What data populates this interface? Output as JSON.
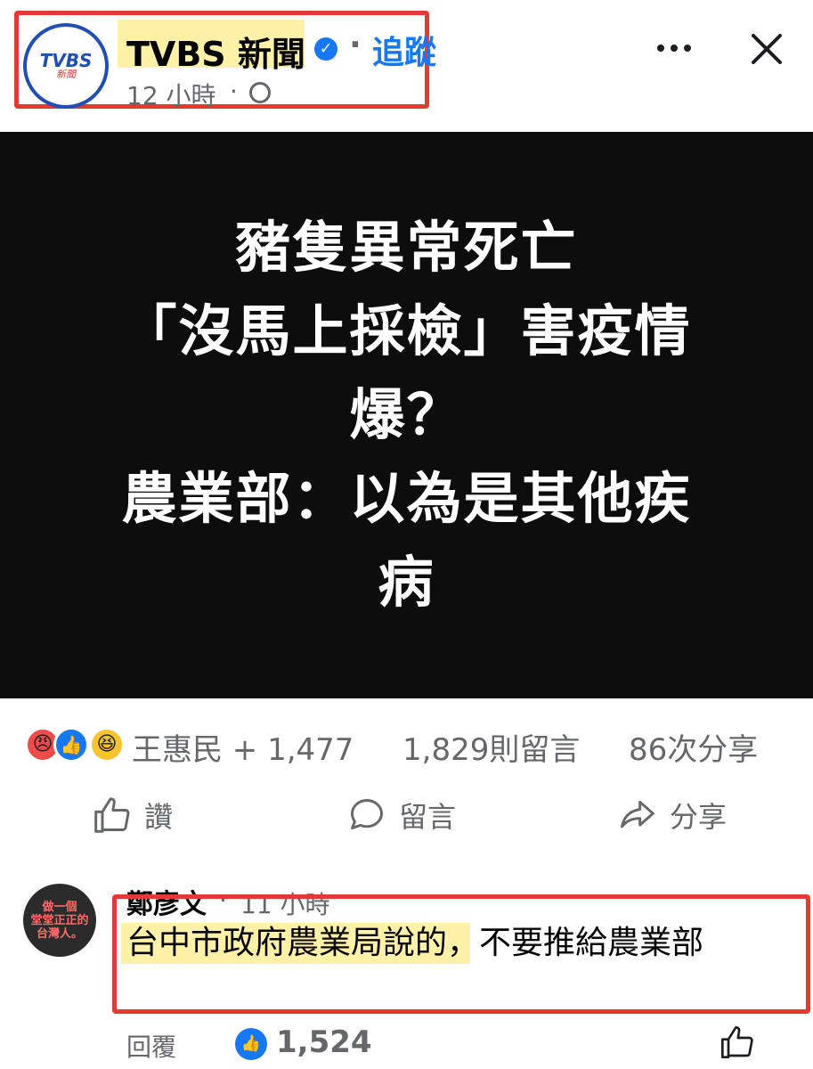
{
  "header": {
    "page_name": "TVBS 新聞",
    "follow_separator": "·",
    "follow_label": "追蹤",
    "time": "12 小時",
    "time_separator": "·",
    "avatar_logo_main": "TVBS",
    "avatar_logo_sub": "新聞"
  },
  "post": {
    "image_text_lines": [
      "豬隻異常死亡",
      "「沒馬上採檢」害疫情",
      "爆？",
      "農業部：以為是其他疾",
      "病"
    ]
  },
  "reactions": {
    "icons": [
      "angry-reaction",
      "like-reaction",
      "haha-reaction"
    ],
    "summary": "王惠民 + 1,477",
    "comments": "1,829則留言",
    "shares": "86次分享"
  },
  "actions": {
    "like": "讚",
    "comment": "留言",
    "share": "分享"
  },
  "comment": {
    "author": "鄭彥文",
    "separator": "·",
    "time": "11 小時",
    "body_highlighted": "台中市政府農業局說的",
    "body_rest": "，不要推給農業部",
    "avatar_text": "做一個\n堂堂正正的\n台灣人。",
    "reply_label": "回覆",
    "like_count": "1,524"
  },
  "colors": {
    "accent": "#1877f2",
    "highlight_box": "#e53935",
    "highlight_fill": "#fff1a8",
    "image_bg": "#0d0d0d"
  }
}
